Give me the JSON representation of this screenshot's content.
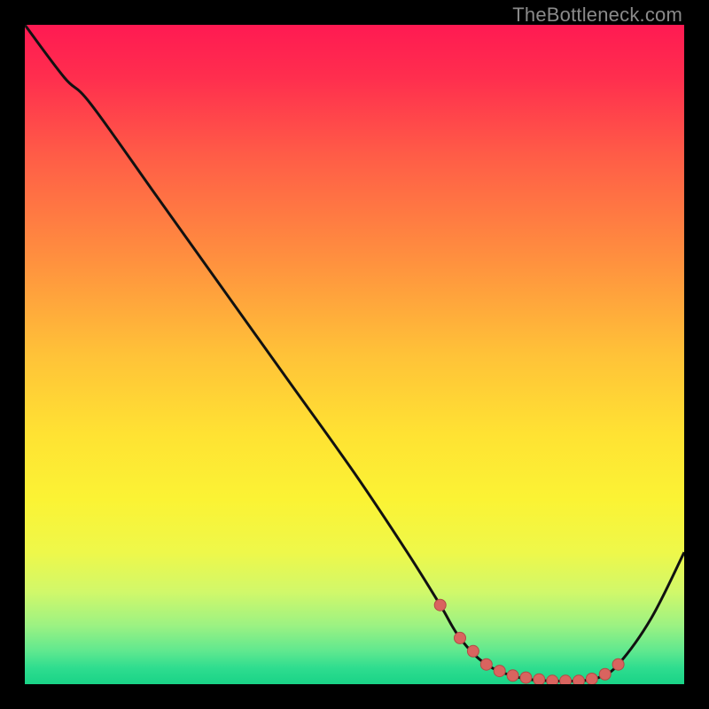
{
  "attribution": "TheBottleneck.com",
  "chart_data": {
    "type": "line",
    "title": "",
    "xlabel": "",
    "ylabel": "",
    "xlim": [
      0,
      100
    ],
    "ylim": [
      0,
      100
    ],
    "series": [
      {
        "name": "bottleneck-curve",
        "x": [
          0,
          6,
          10,
          20,
          30,
          40,
          50,
          58,
          63,
          66,
          70,
          75,
          80,
          84,
          87,
          90,
          95,
          100
        ],
        "y": [
          100,
          92,
          88,
          74,
          60,
          46,
          32,
          20,
          12,
          7,
          3,
          1,
          0.5,
          0.5,
          1,
          3,
          10,
          20
        ]
      }
    ],
    "markers": {
      "name": "highlight-dots",
      "x": [
        63,
        66,
        68,
        70,
        72,
        74,
        76,
        78,
        80,
        82,
        84,
        86,
        88,
        90
      ],
      "y": [
        12,
        7,
        5,
        3,
        2,
        1.3,
        1,
        0.7,
        0.5,
        0.5,
        0.5,
        0.8,
        1.5,
        3
      ]
    },
    "gradient_stops": [
      {
        "offset": 0.0,
        "color": "#ff1a52"
      },
      {
        "offset": 0.08,
        "color": "#ff2e4e"
      },
      {
        "offset": 0.2,
        "color": "#ff5d47"
      },
      {
        "offset": 0.35,
        "color": "#ff8e3f"
      },
      {
        "offset": 0.5,
        "color": "#ffc238"
      },
      {
        "offset": 0.62,
        "color": "#ffe233"
      },
      {
        "offset": 0.72,
        "color": "#fbf334"
      },
      {
        "offset": 0.8,
        "color": "#eef84a"
      },
      {
        "offset": 0.86,
        "color": "#d1f86a"
      },
      {
        "offset": 0.91,
        "color": "#9df282"
      },
      {
        "offset": 0.95,
        "color": "#5fe88f"
      },
      {
        "offset": 0.975,
        "color": "#2fdd8f"
      },
      {
        "offset": 1.0,
        "color": "#19d387"
      }
    ],
    "curve_color": "#111111",
    "marker_fill": "#d9645f",
    "marker_stroke": "#b24a46"
  }
}
